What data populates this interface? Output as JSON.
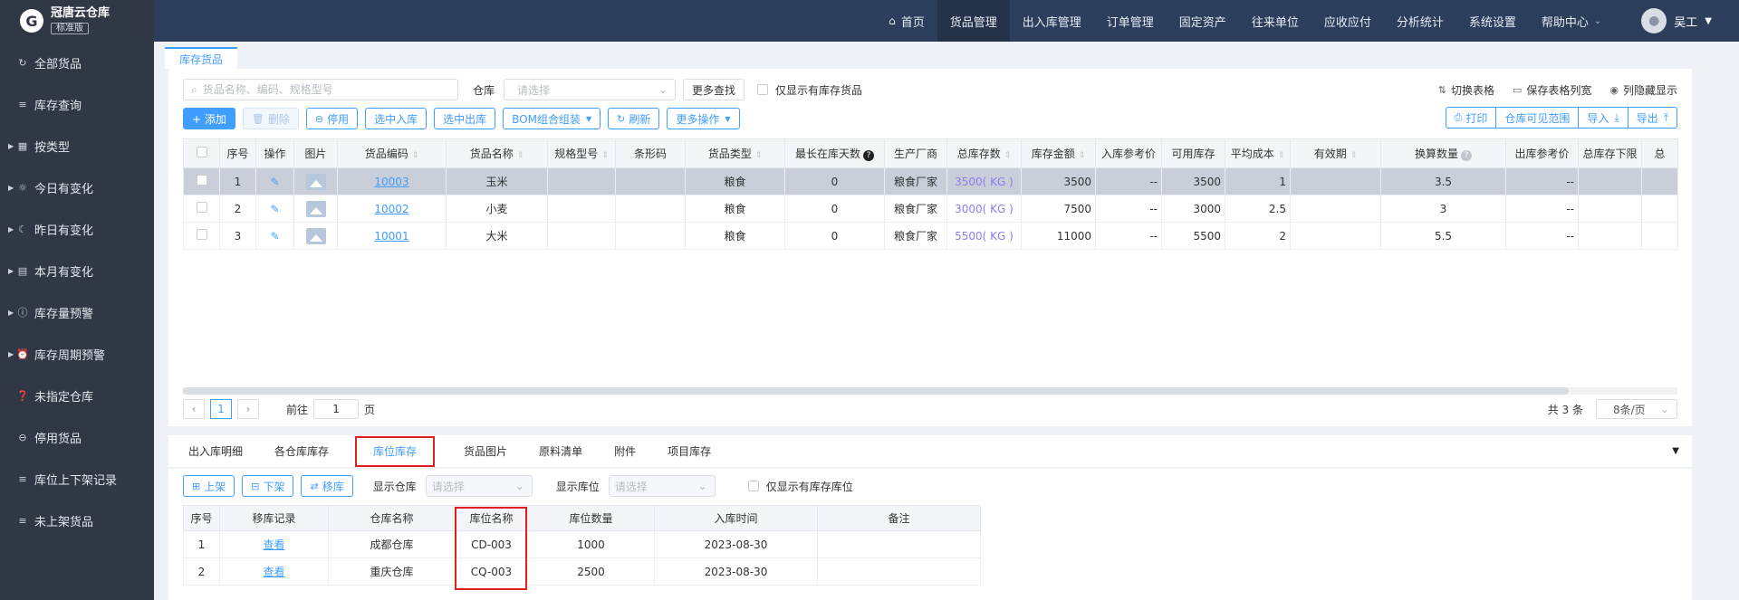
{
  "brand": {
    "logo_letter": "G",
    "name": "冠唐云仓库",
    "edition": "标准版"
  },
  "sidebar": {
    "items": [
      {
        "label": "全部货品",
        "icon": "refresh-icon",
        "glyph": "↻",
        "caret": false
      },
      {
        "label": "库存查询",
        "icon": "list-icon",
        "glyph": "≡",
        "caret": false
      },
      {
        "label": "按类型",
        "icon": "grid-icon",
        "glyph": "▦",
        "caret": true
      },
      {
        "label": "今日有变化",
        "icon": "sun-icon",
        "glyph": "☼",
        "caret": true
      },
      {
        "label": "昨日有变化",
        "icon": "moon-icon",
        "glyph": "☾",
        "caret": true
      },
      {
        "label": "本月有变化",
        "icon": "calendar-icon",
        "glyph": "▤",
        "caret": true
      },
      {
        "label": "库存量预警",
        "icon": "warning-icon",
        "glyph": "ⓘ",
        "caret": true
      },
      {
        "label": "库存周期预警",
        "icon": "alarm-clock-icon",
        "glyph": "⏰",
        "caret": true
      },
      {
        "label": "未指定仓库",
        "icon": "question-icon",
        "glyph": "❓",
        "caret": false
      },
      {
        "label": "停用货品",
        "icon": "minus-circle-icon",
        "glyph": "⊖",
        "caret": false
      },
      {
        "label": "库位上下架记录",
        "icon": "list-icon",
        "glyph": "≡",
        "caret": false
      },
      {
        "label": "未上架货品",
        "icon": "list-icon",
        "glyph": "≡",
        "caret": false
      }
    ]
  },
  "topnav": {
    "items": [
      {
        "label": "首页",
        "active": false,
        "home": true
      },
      {
        "label": "货品管理",
        "active": true
      },
      {
        "label": "出入库管理",
        "active": false
      },
      {
        "label": "订单管理",
        "active": false
      },
      {
        "label": "固定资产",
        "active": false
      },
      {
        "label": "往来单位",
        "active": false
      },
      {
        "label": "应收应付",
        "active": false
      },
      {
        "label": "分析统计",
        "active": false
      },
      {
        "label": "系统设置",
        "active": false
      },
      {
        "label": "帮助中心",
        "active": false,
        "dropdown": true
      }
    ],
    "user_name": "吴工"
  },
  "page_tab": "库存货品",
  "filters": {
    "search_placeholder": "货品名称、编码、规格型号",
    "warehouse_label": "仓库",
    "warehouse_placeholder": "请选择",
    "more_search": "更多查找",
    "only_stock": "仅显示有库存货品"
  },
  "right_tools": [
    {
      "label": "切换表格",
      "icon": "switch-icon",
      "glyph": "⇅"
    },
    {
      "label": "保存表格列宽",
      "icon": "folder-icon",
      "glyph": "▭"
    },
    {
      "label": "列隐藏显示",
      "icon": "eye-icon",
      "glyph": "◉"
    }
  ],
  "actions": {
    "add": "+ 添加",
    "delete": "删除",
    "disable": "停用",
    "in": "选中入库",
    "out": "选中出库",
    "bom": "BOM组合组装",
    "refresh": "刷新",
    "more": "更多操作"
  },
  "right_buttons": {
    "print": "打印",
    "scope": "仓库可见范围",
    "import": "导入",
    "export": "导出"
  },
  "table": {
    "columns": [
      "序号",
      "操作",
      "图片",
      "货品编码",
      "货品名称",
      "规格型号",
      "条形码",
      "货品类型",
      "最长在库天数",
      "生产厂商",
      "总库存数",
      "库存金额",
      "入库参考价",
      "可用库存",
      "平均成本",
      "有效期",
      "换算数量",
      "出库参考价",
      "总库存下限",
      "总"
    ],
    "rows": [
      {
        "no": "1",
        "code": "10003",
        "name": "玉米",
        "spec": "",
        "barcode": "",
        "type": "粮食",
        "days": "0",
        "maker": "粮食厂家",
        "stock": "3500( KG )",
        "amount": "3500",
        "in_price": "--",
        "avail": "3500",
        "avg": "1",
        "expiry": "",
        "conv": "3.5",
        "out_price": "--",
        "min": "",
        "selected": true
      },
      {
        "no": "2",
        "code": "10002",
        "name": "小麦",
        "spec": "",
        "barcode": "",
        "type": "粮食",
        "days": "0",
        "maker": "粮食厂家",
        "stock": "3000( KG )",
        "amount": "7500",
        "in_price": "--",
        "avail": "3000",
        "avg": "2.5",
        "expiry": "",
        "conv": "3",
        "out_price": "--",
        "min": "",
        "selected": false
      },
      {
        "no": "3",
        "code": "10001",
        "name": "大米",
        "spec": "",
        "barcode": "",
        "type": "粮食",
        "days": "0",
        "maker": "粮食厂家",
        "stock": "5500( KG )",
        "amount": "11000",
        "in_price": "--",
        "avail": "5500",
        "avg": "2",
        "expiry": "",
        "conv": "5.5",
        "out_price": "--",
        "min": "",
        "selected": false
      }
    ]
  },
  "pager": {
    "current": "1",
    "goto_label": "前往",
    "goto_value": "1",
    "page_suffix": "页",
    "total": "共 3 条",
    "size": "8条/页"
  },
  "subtabs": [
    "出入库明细",
    "各仓库库存",
    "库位库存",
    "货品图片",
    "原料清单",
    "附件",
    "项目库存"
  ],
  "active_subtab": 2,
  "bottom": {
    "shelf_up": "上架",
    "shelf_down": "下架",
    "move": "移库",
    "show_wh_label": "显示仓库",
    "show_wh_placeholder": "请选择",
    "show_loc_label": "显示库位",
    "show_loc_placeholder": "请选择",
    "only_stock_loc": "仅显示有库存库位",
    "columns": [
      "序号",
      "移库记录",
      "仓库名称",
      "库位名称",
      "库位数量",
      "入库时间",
      "备注"
    ],
    "rows": [
      {
        "no": "1",
        "record": "查看",
        "wh": "成都仓库",
        "loc": "CD-003",
        "qty": "1000",
        "date": "2023-08-30",
        "note": ""
      },
      {
        "no": "2",
        "record": "查看",
        "wh": "重庆仓库",
        "loc": "CQ-003",
        "qty": "2500",
        "date": "2023-08-30",
        "note": ""
      }
    ]
  },
  "colors": {
    "primary": "#409eff",
    "sidebar": "#303846",
    "topnav": "#2c3e5c",
    "highlight": "#e02020"
  }
}
